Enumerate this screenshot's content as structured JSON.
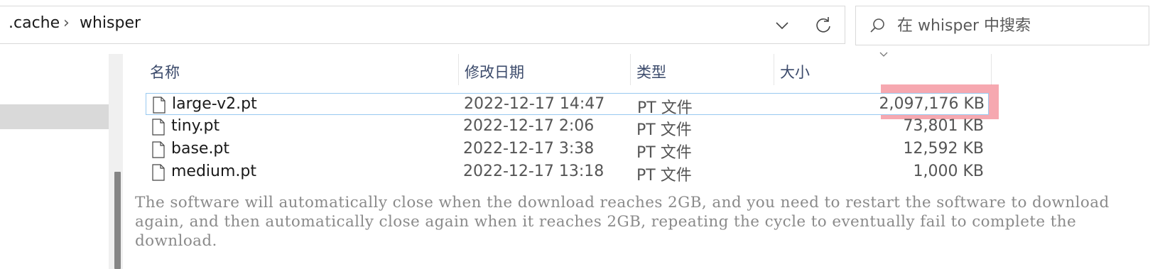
{
  "breadcrumb": {
    "items": [
      ".cache",
      "whisper"
    ],
    "separator": "›"
  },
  "search": {
    "placeholder": "在 whisper 中搜索"
  },
  "columns": {
    "name": "名称",
    "modified": "修改日期",
    "type": "类型",
    "size": "大小"
  },
  "files": [
    {
      "name": "large-v2.pt",
      "modified": "2022-12-17 14:47",
      "type": "PT 文件",
      "size": "2,097,176 KB",
      "selected": true
    },
    {
      "name": "tiny.pt",
      "modified": "2022-12-17 2:06",
      "type": "PT 文件",
      "size": "73,801 KB"
    },
    {
      "name": "base.pt",
      "modified": "2022-12-17 3:38",
      "type": "PT 文件",
      "size": "12,592 KB"
    },
    {
      "name": "medium.pt",
      "modified": "2022-12-17 13:18",
      "type": "PT 文件",
      "size": "1,000 KB"
    }
  ],
  "note": "The software will automatically close when the download reaches 2GB, and you need to restart the software to download again, and then automatically close again when it reaches 2GB, repeating the cycle to eventually fail to complete the download.",
  "colors": {
    "highlight": "#ee6070",
    "selection_border": "#99c9f0",
    "header_text": "#3b4a6b"
  }
}
